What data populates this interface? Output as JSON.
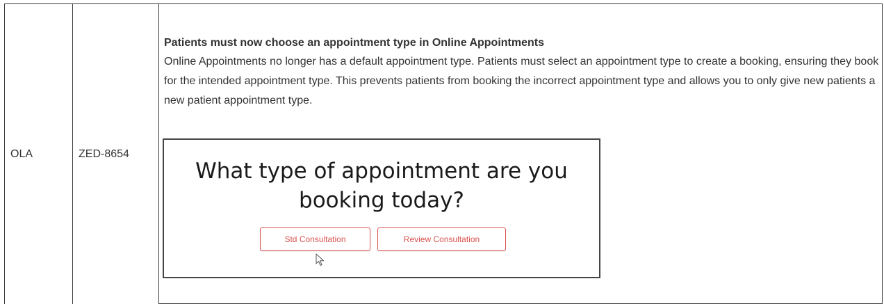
{
  "row": {
    "product": "OLA",
    "ticket_id": "ZED-8654",
    "title": "Patients must now choose an appointment type in Online Appointments",
    "body": "Online Appointments no longer has a default appointment type. Patients must select an appointment type to create a booking,  ensuring they book for the intended appointment type. This prevents patients from booking the incorrect appointment type and allows you to only give new patients a new patient appointment type."
  },
  "screenshot": {
    "heading_line1": "What type of appointment are you",
    "heading_line2": "booking today?",
    "buttons": [
      "Std Consultation",
      "Review Consultation"
    ],
    "accent_color": "#d9534f",
    "cursor_icon": "mouse-pointer-icon"
  }
}
